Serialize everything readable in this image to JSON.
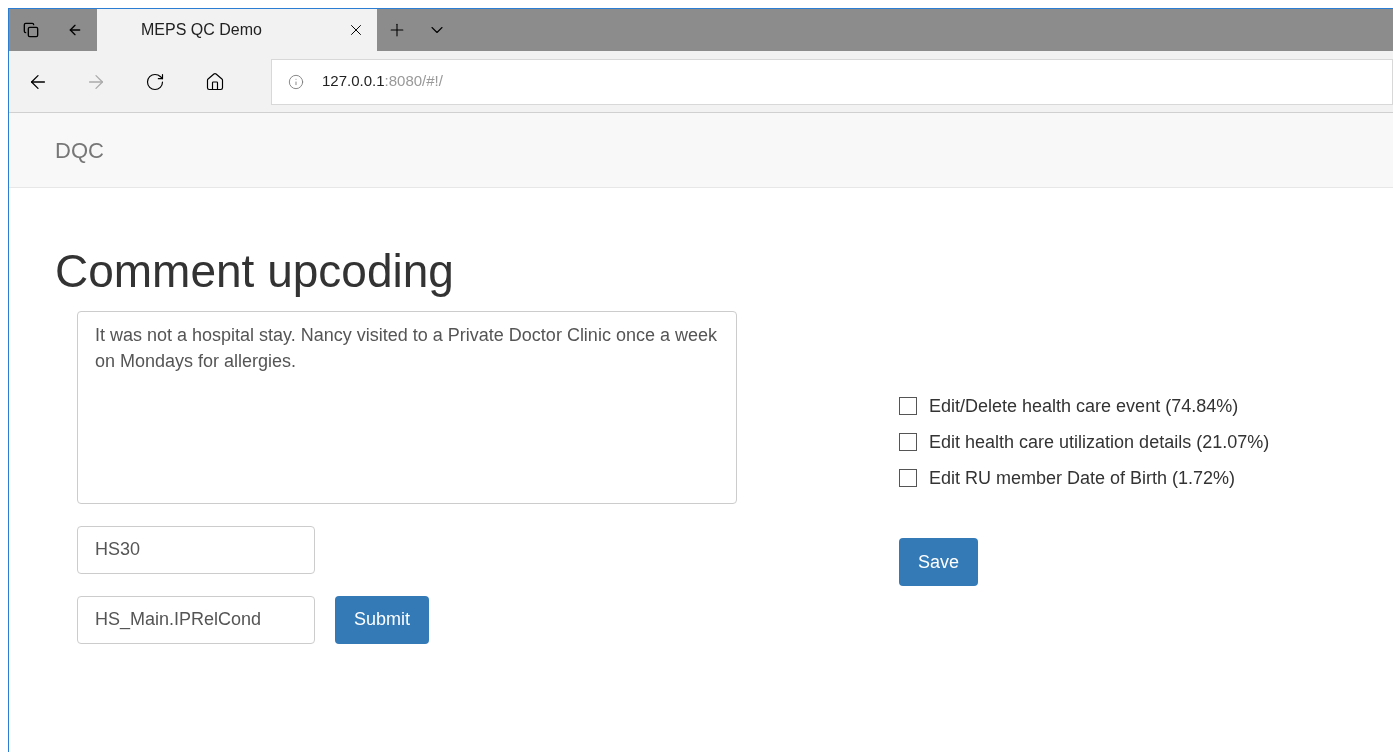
{
  "browser": {
    "tab": {
      "title": "MEPS QC Demo",
      "selected": true
    },
    "address": {
      "host": "127.0.0.1",
      "path": ":8080/#!/"
    }
  },
  "navbar": {
    "brand": "DQC"
  },
  "page": {
    "heading": "Comment upcoding",
    "comment": "It was not a hospital stay. Nancy visited to a Private Doctor Clinic once a week on Mondays for allergies.",
    "code_field": "HS30",
    "variable_field": "HS_Main.IPRelCond",
    "submit": "Submit",
    "options": [
      {
        "label": "Edit/Delete health care event (74.84%)",
        "checked": false
      },
      {
        "label": "Edit health care utilization details (21.07%)",
        "checked": false
      },
      {
        "label": "Edit RU member Date of Birth (1.72%)",
        "checked": false
      }
    ],
    "save": "Save"
  }
}
